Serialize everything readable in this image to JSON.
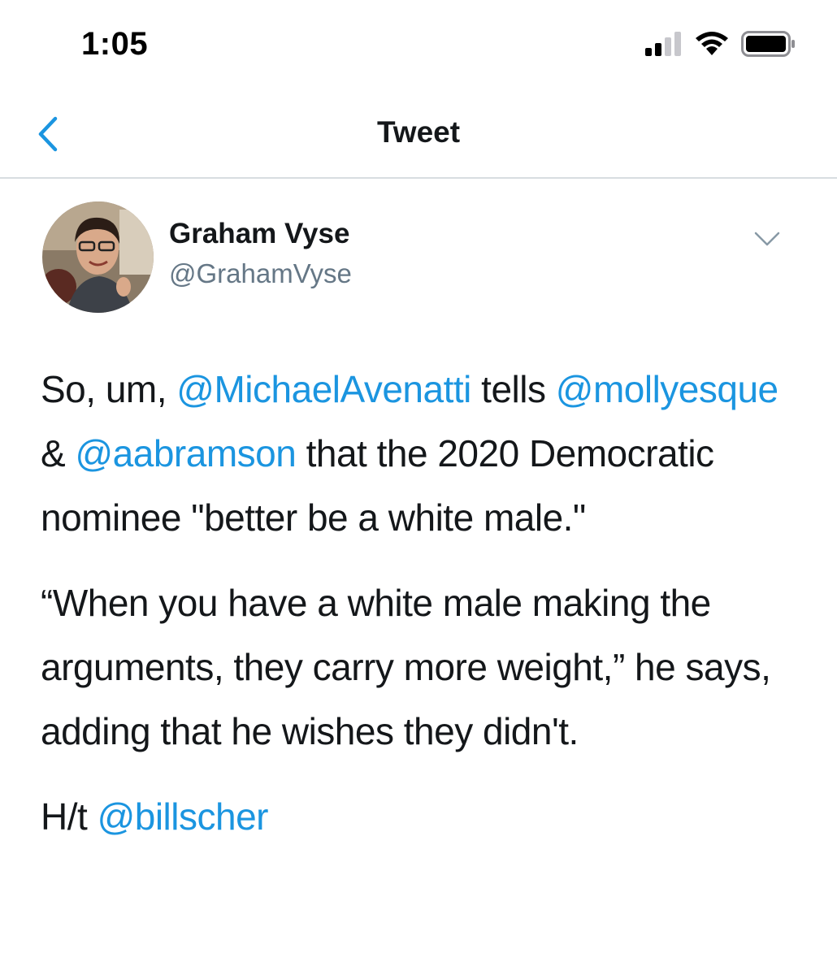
{
  "status_bar": {
    "time": "1:05",
    "icons": [
      "cellular-signal-icon",
      "wifi-icon",
      "battery-icon"
    ]
  },
  "nav": {
    "back_icon": "chevron-left-icon",
    "title": "Tweet"
  },
  "tweet": {
    "author": {
      "name": "Graham Vyse",
      "handle": "@GrahamVyse"
    },
    "menu_icon": "chevron-down-icon",
    "paragraph1": {
      "t1": "So, um, ",
      "m1": "@MichaelAvenatti",
      "t2": " tells ",
      "m2": "@mollyesque",
      "t3": " & ",
      "m3": "@aabramson",
      "t4": " that the 2020 Democratic nominee \"better be a white male.\""
    },
    "paragraph2": "“When you have a white male making the arguments, they carry more weight,” he says, adding that he wishes they didn't.",
    "paragraph3": {
      "t1": "H/t ",
      "m1": "@billscher"
    }
  },
  "colors": {
    "link": "#1b95e0",
    "text": "#14171a",
    "secondary": "#657786",
    "divider": "#d8dde1"
  }
}
